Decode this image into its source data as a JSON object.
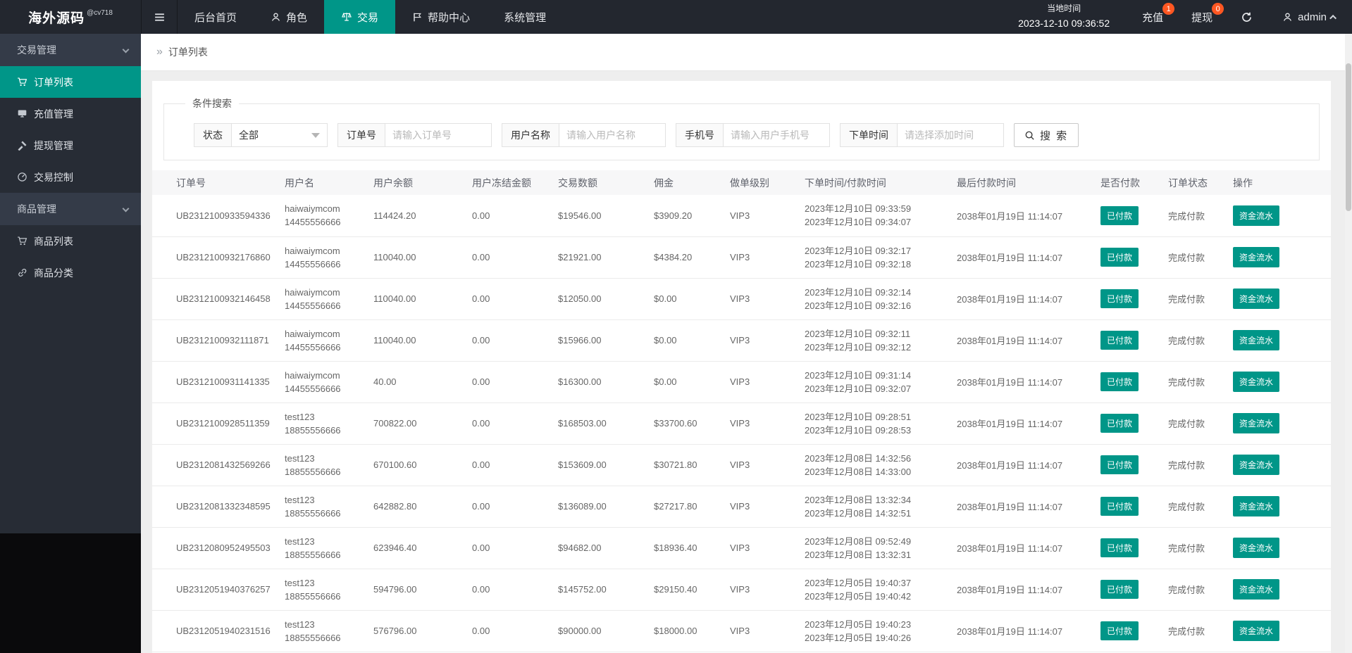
{
  "colors": {
    "accent": "#009688",
    "badge": "#ff5722",
    "navbar_bg": "#23272f",
    "sidebar_bg": "#272c35"
  },
  "navbar": {
    "logo": "海外源码",
    "logo_badge": "@cv718",
    "menu": [
      {
        "label": "后台首页"
      },
      {
        "label": "角色",
        "icon": "user-icon"
      },
      {
        "label": "交易",
        "icon": "scales-icon",
        "active": true
      },
      {
        "label": "帮助中心",
        "icon": "flag-icon"
      },
      {
        "label": "系统管理"
      }
    ],
    "local_time_label": "当地时间",
    "local_time": "2023-12-10 09:36:52",
    "recharge_label": "充值",
    "recharge_badge": "1",
    "withdraw_label": "提现",
    "withdraw_badge": "0",
    "username": "admin"
  },
  "sidebar": {
    "groups": [
      {
        "label": "交易管理",
        "items": [
          {
            "label": "订单列表",
            "icon": "cart-icon",
            "active": true
          },
          {
            "label": "充值管理",
            "icon": "board-icon"
          },
          {
            "label": "提现管理",
            "icon": "gavel-icon"
          },
          {
            "label": "交易控制",
            "icon": "gauge-icon"
          }
        ]
      },
      {
        "label": "商品管理",
        "items": [
          {
            "label": "商品列表",
            "icon": "cart-icon"
          },
          {
            "label": "商品分类",
            "icon": "link-icon"
          }
        ]
      }
    ]
  },
  "breadcrumb": {
    "icon": "»",
    "title": "订单列表"
  },
  "filters": {
    "legend": "条件搜索",
    "status_label": "状态",
    "status_value": "全部",
    "order_no_label": "订单号",
    "order_no_placeholder": "请输入订单号",
    "username_label": "用户名称",
    "username_placeholder": "请输入用户名称",
    "phone_label": "手机号",
    "phone_placeholder": "请输入用户手机号",
    "time_label": "下单时间",
    "time_placeholder": "请选择添加时间",
    "search_label": "搜 索"
  },
  "table": {
    "headers": [
      "订单号",
      "用户名",
      "用户余额",
      "用户冻结金额",
      "交易数额",
      "佣金",
      "做单级别",
      "下单时间/付款时间",
      "最后付款时间",
      "是否付款",
      "订单状态",
      "操作"
    ],
    "rows": [
      {
        "order_no": "UB2312100933594336",
        "user": "haiwaiymcom",
        "phone": "14455556666",
        "balance": "114424.20",
        "frozen": "0.00",
        "amount": "$19546.00",
        "commission": "$3909.20",
        "level": "VIP3",
        "order_time": "2023年12月10日 09:33:59",
        "pay_time": "2023年12月10日 09:34:07",
        "last_pay_time": "2038年01月19日 11:14:07",
        "paid": "已付款",
        "status": "完成付款",
        "action": "资金流水"
      },
      {
        "order_no": "UB2312100932176860",
        "user": "haiwaiymcom",
        "phone": "14455556666",
        "balance": "110040.00",
        "frozen": "0.00",
        "amount": "$21921.00",
        "commission": "$4384.20",
        "level": "VIP3",
        "order_time": "2023年12月10日 09:32:17",
        "pay_time": "2023年12月10日 09:32:18",
        "last_pay_time": "2038年01月19日 11:14:07",
        "paid": "已付款",
        "status": "完成付款",
        "action": "资金流水"
      },
      {
        "order_no": "UB2312100932146458",
        "user": "haiwaiymcom",
        "phone": "14455556666",
        "balance": "110040.00",
        "frozen": "0.00",
        "amount": "$12050.00",
        "commission": "$0.00",
        "level": "VIP3",
        "order_time": "2023年12月10日 09:32:14",
        "pay_time": "2023年12月10日 09:32:16",
        "last_pay_time": "2038年01月19日 11:14:07",
        "paid": "已付款",
        "status": "完成付款",
        "action": "资金流水"
      },
      {
        "order_no": "UB2312100932111871",
        "user": "haiwaiymcom",
        "phone": "14455556666",
        "balance": "110040.00",
        "frozen": "0.00",
        "amount": "$15966.00",
        "commission": "$0.00",
        "level": "VIP3",
        "order_time": "2023年12月10日 09:32:11",
        "pay_time": "2023年12月10日 09:32:12",
        "last_pay_time": "2038年01月19日 11:14:07",
        "paid": "已付款",
        "status": "完成付款",
        "action": "资金流水"
      },
      {
        "order_no": "UB2312100931141335",
        "user": "haiwaiymcom",
        "phone": "14455556666",
        "balance": "40.00",
        "frozen": "0.00",
        "amount": "$16300.00",
        "commission": "$0.00",
        "level": "VIP3",
        "order_time": "2023年12月10日 09:31:14",
        "pay_time": "2023年12月10日 09:32:07",
        "last_pay_time": "2038年01月19日 11:14:07",
        "paid": "已付款",
        "status": "完成付款",
        "action": "资金流水"
      },
      {
        "order_no": "UB2312100928511359",
        "user": "test123",
        "phone": "18855556666",
        "balance": "700822.00",
        "frozen": "0.00",
        "amount": "$168503.00",
        "commission": "$33700.60",
        "level": "VIP3",
        "order_time": "2023年12月10日 09:28:51",
        "pay_time": "2023年12月10日 09:28:53",
        "last_pay_time": "2038年01月19日 11:14:07",
        "paid": "已付款",
        "status": "完成付款",
        "action": "资金流水"
      },
      {
        "order_no": "UB2312081432569266",
        "user": "test123",
        "phone": "18855556666",
        "balance": "670100.60",
        "frozen": "0.00",
        "amount": "$153609.00",
        "commission": "$30721.80",
        "level": "VIP3",
        "order_time": "2023年12月08日 14:32:56",
        "pay_time": "2023年12月08日 14:33:00",
        "last_pay_time": "2038年01月19日 11:14:07",
        "paid": "已付款",
        "status": "完成付款",
        "action": "资金流水"
      },
      {
        "order_no": "UB2312081332348595",
        "user": "test123",
        "phone": "18855556666",
        "balance": "642882.80",
        "frozen": "0.00",
        "amount": "$136089.00",
        "commission": "$27217.80",
        "level": "VIP3",
        "order_time": "2023年12月08日 13:32:34",
        "pay_time": "2023年12月08日 14:32:51",
        "last_pay_time": "2038年01月19日 11:14:07",
        "paid": "已付款",
        "status": "完成付款",
        "action": "资金流水"
      },
      {
        "order_no": "UB2312080952495503",
        "user": "test123",
        "phone": "18855556666",
        "balance": "623946.40",
        "frozen": "0.00",
        "amount": "$94682.00",
        "commission": "$18936.40",
        "level": "VIP3",
        "order_time": "2023年12月08日 09:52:49",
        "pay_time": "2023年12月08日 13:32:31",
        "last_pay_time": "2038年01月19日 11:14:07",
        "paid": "已付款",
        "status": "完成付款",
        "action": "资金流水"
      },
      {
        "order_no": "UB2312051940376257",
        "user": "test123",
        "phone": "18855556666",
        "balance": "594796.00",
        "frozen": "0.00",
        "amount": "$145752.00",
        "commission": "$29150.40",
        "level": "VIP3",
        "order_time": "2023年12月05日 19:40:37",
        "pay_time": "2023年12月05日 19:40:42",
        "last_pay_time": "2038年01月19日 11:14:07",
        "paid": "已付款",
        "status": "完成付款",
        "action": "资金流水"
      },
      {
        "order_no": "UB2312051940231516",
        "user": "test123",
        "phone": "18855556666",
        "balance": "576796.00",
        "frozen": "0.00",
        "amount": "$90000.00",
        "commission": "$18000.00",
        "level": "VIP3",
        "order_time": "2023年12月05日 19:40:23",
        "pay_time": "2023年12月05日 19:40:26",
        "last_pay_time": "2038年01月19日 11:14:07",
        "paid": "已付款",
        "status": "完成付款",
        "action": "资金流水"
      }
    ]
  }
}
